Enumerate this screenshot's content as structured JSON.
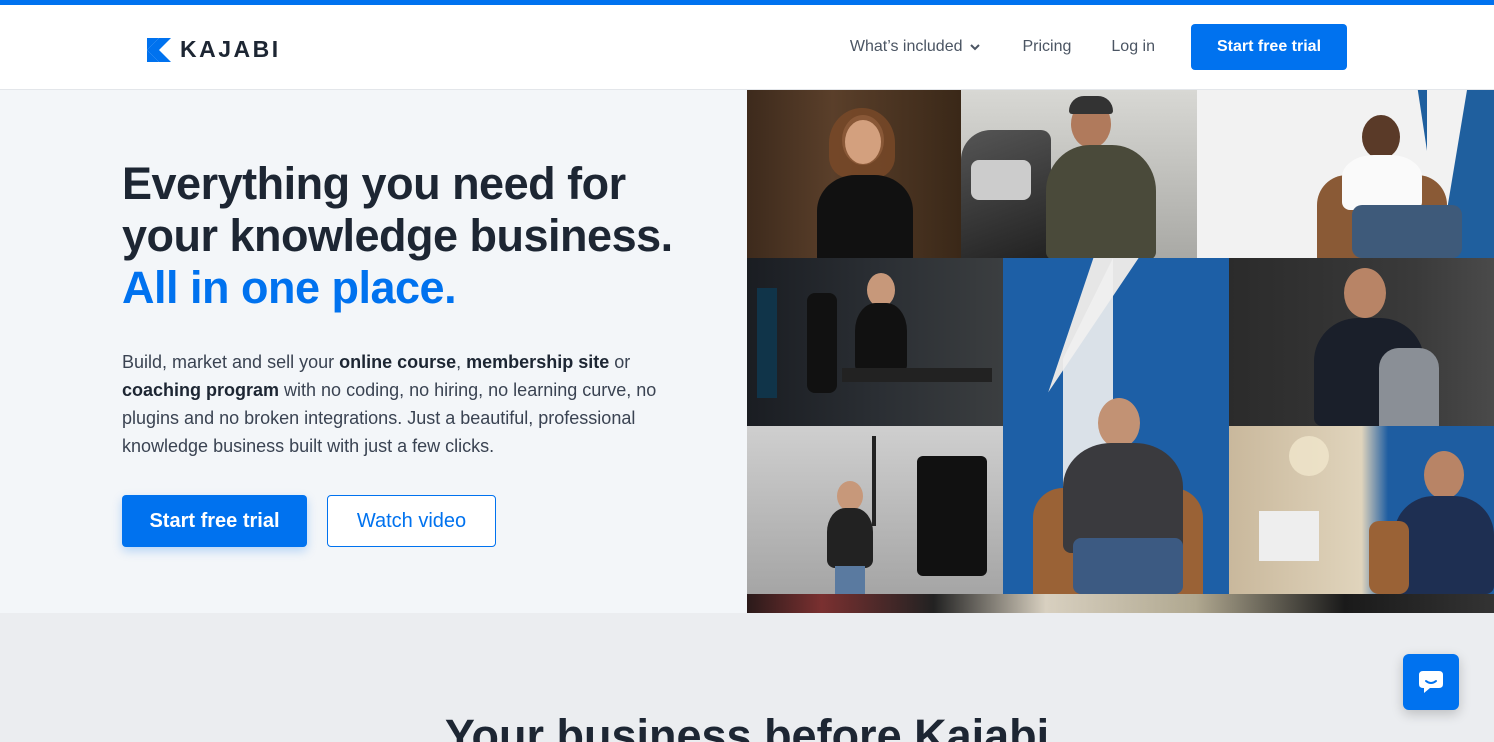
{
  "brand": {
    "name": "KAJABI",
    "accent": "#0072ef"
  },
  "nav": {
    "whats_included": "What’s included",
    "pricing": "Pricing",
    "login": "Log in",
    "cta": "Start free trial"
  },
  "hero": {
    "title_line1": "Everything you need for",
    "title_line2": "your knowledge business.",
    "title_accent": "All in one place.",
    "lead": {
      "p1": "Build, market and sell your ",
      "b1": "online course",
      "p2": ", ",
      "b2": "membership site",
      "p3": " or ",
      "b3": "coaching program",
      "p4": " with no coding, no hiring, no learning curve, no plugins and no broken integrations. Just a beautiful, professional knowledge business built with just a few clicks."
    },
    "primary_cta": "Start free trial",
    "secondary_cta": "Watch video"
  },
  "section2": {
    "heading": "Your business before Kajabi"
  },
  "chat": {
    "icon": "chat-bubble-icon"
  }
}
